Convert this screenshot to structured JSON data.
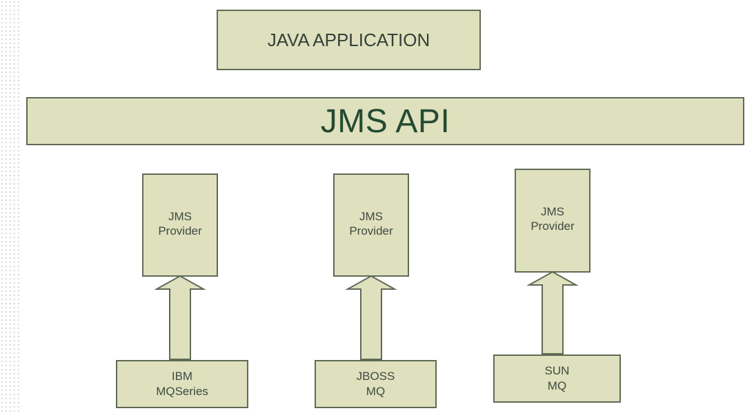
{
  "diagram": {
    "top_box": {
      "label": "JAVA APPLICATION"
    },
    "api_bar": {
      "label": "JMS API"
    },
    "providers": [
      {
        "label": "JMS\nProvider",
        "source_label": "IBM\nMQSeries"
      },
      {
        "label": "JMS\nProvider",
        "source_label": "JBOSS\nMQ"
      },
      {
        "label": "JMS\nProvider",
        "source_label": "SUN\nMQ"
      }
    ],
    "colors": {
      "box_fill": "#dfe0bd",
      "box_border": "#5f6a55",
      "text": "#2f4a2f"
    }
  }
}
